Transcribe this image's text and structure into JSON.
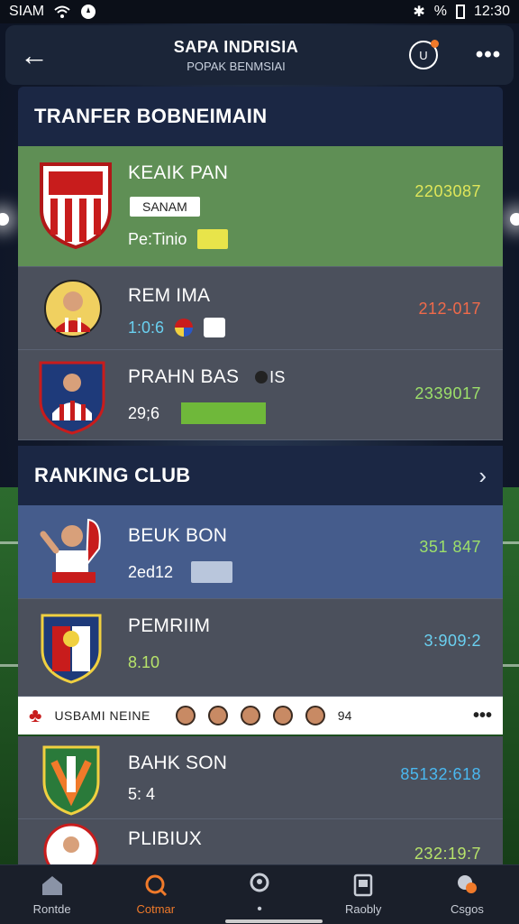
{
  "status_bar": {
    "carrier": "SIAM",
    "battery": "%",
    "time": "12:30"
  },
  "header": {
    "title": "SAPA INDRISIA",
    "subtitle": "POPAK BENMSIAI",
    "badge_label": "U"
  },
  "transfer": {
    "title": "TRANFER BOBNEIMAIN",
    "rows": [
      {
        "name": "KEAIK PAN",
        "tag": "SANAM",
        "sub": "Pe:Tinio",
        "value": "2203087",
        "value_color": "#e0e65a"
      },
      {
        "name": "REM IMA",
        "sub": "1:0:6",
        "value": "212-017",
        "value_color": "#f06a4a"
      },
      {
        "name": "PRAHN BAS",
        "sub": "29;6",
        "extra": "IS",
        "value": "2339017",
        "value_color": "#9de06a"
      }
    ]
  },
  "ranking": {
    "title": "RANKING CLUB",
    "rows": [
      {
        "name": "BEUK BON",
        "sub": "2ed12",
        "value": "351 847",
        "value_color": "#9de06a"
      },
      {
        "name": "PEMRIIM",
        "sub": "8.10",
        "sub_color": "#b7e36a",
        "value": "3:909:2",
        "value_color": "#6ad0f0"
      },
      {
        "name": "BAHK SON",
        "sub": "5: 4",
        "value": "85132:618",
        "value_color": "#4ab8f0"
      },
      {
        "name": "PLIBIUX",
        "value": "232:19:7",
        "value_color": "#b7e36a"
      }
    ]
  },
  "strip": {
    "label": "USBAMI NEINE",
    "count": "94"
  },
  "nav": [
    {
      "label": "Rontde",
      "icon": "home-icon"
    },
    {
      "label": "Cotmar",
      "icon": "search-icon",
      "active": true
    },
    {
      "label": "",
      "icon": "person-search-icon"
    },
    {
      "label": "Raobly",
      "icon": "card-icon"
    },
    {
      "label": "Csgos",
      "icon": "chat-icon"
    }
  ],
  "colors": {
    "accent": "#f07a2a",
    "green_row": "#5f8f55",
    "blue_row": "#455c8c",
    "header_bg": "#1b2744"
  }
}
